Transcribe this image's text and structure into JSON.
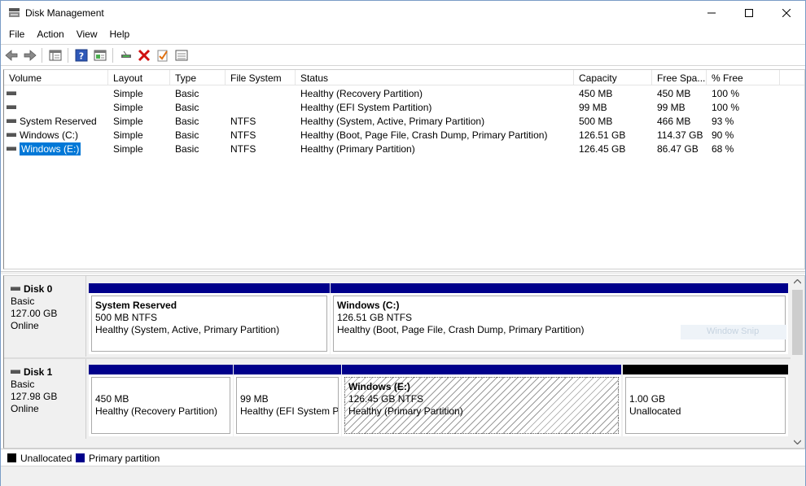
{
  "window": {
    "title": "Disk Management"
  },
  "menu": [
    "File",
    "Action",
    "View",
    "Help"
  ],
  "columns": [
    "Volume",
    "Layout",
    "Type",
    "File System",
    "Status",
    "Capacity",
    "Free Spa...",
    "% Free"
  ],
  "volumes": [
    {
      "volume": "",
      "layout": "Simple",
      "type": "Basic",
      "fs": "",
      "status": "Healthy (Recovery Partition)",
      "capacity": "450 MB",
      "free": "450 MB",
      "pct": "100 %"
    },
    {
      "volume": "",
      "layout": "Simple",
      "type": "Basic",
      "fs": "",
      "status": "Healthy (EFI System Partition)",
      "capacity": "99 MB",
      "free": "99 MB",
      "pct": "100 %"
    },
    {
      "volume": "System Reserved",
      "layout": "Simple",
      "type": "Basic",
      "fs": "NTFS",
      "status": "Healthy (System, Active, Primary Partition)",
      "capacity": "500 MB",
      "free": "466 MB",
      "pct": "93 %"
    },
    {
      "volume": "Windows (C:)",
      "layout": "Simple",
      "type": "Basic",
      "fs": "NTFS",
      "status": "Healthy (Boot, Page File, Crash Dump, Primary Partition)",
      "capacity": "126.51 GB",
      "free": "114.37 GB",
      "pct": "90 %"
    },
    {
      "volume": "Windows (E:)",
      "layout": "Simple",
      "type": "Basic",
      "fs": "NTFS",
      "status": "Healthy (Primary Partition)",
      "capacity": "126.45 GB",
      "free": "86.47 GB",
      "pct": "68 %"
    }
  ],
  "disks": [
    {
      "name": "Disk 0",
      "kind": "Basic",
      "size": "127.00 GB",
      "state": "Online",
      "partitions": [
        {
          "name": "System Reserved",
          "size": "500 MB NTFS",
          "status": "Healthy (System, Active, Primary Partition)"
        },
        {
          "name": "Windows  (C:)",
          "size": "126.51 GB NTFS",
          "status": "Healthy (Boot, Page File, Crash Dump, Primary Partition)"
        }
      ]
    },
    {
      "name": "Disk 1",
      "kind": "Basic",
      "size": "127.98 GB",
      "state": "Online",
      "partitions": [
        {
          "name": "",
          "size": "450 MB",
          "status": "Healthy (Recovery Partition)"
        },
        {
          "name": "",
          "size": "99 MB",
          "status": "Healthy (EFI System Pa"
        },
        {
          "name": "Windows  (E:)",
          "size": "126.45 GB NTFS",
          "status": "Healthy (Primary Partition)"
        },
        {
          "name": "",
          "size": "1.00 GB",
          "status": "Unallocated"
        }
      ]
    }
  ],
  "legend": [
    {
      "label": "Unallocated",
      "color": "#000000"
    },
    {
      "label": "Primary partition",
      "color": "#00008b"
    }
  ],
  "watermark": "Window Snip",
  "colors": {
    "primary_bar": "#00008b",
    "unallocated_bar": "#000000",
    "selection": "#0078d7"
  }
}
